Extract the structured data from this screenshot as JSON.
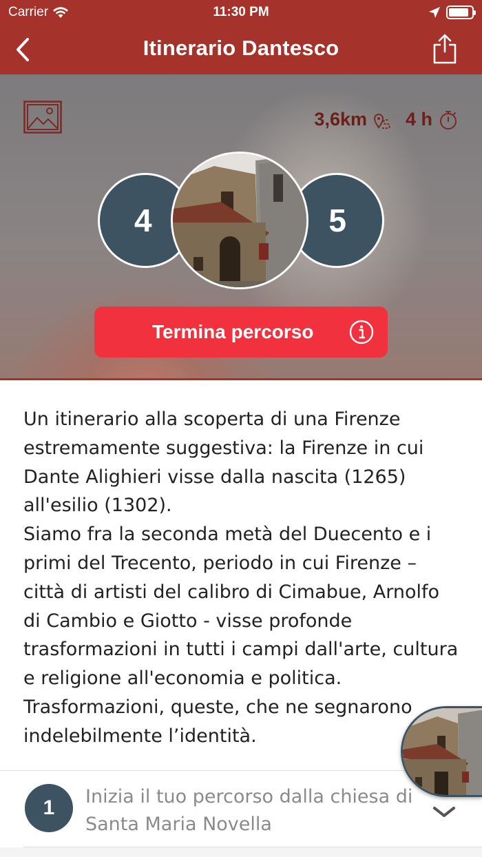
{
  "status_bar": {
    "carrier": "Carrier",
    "time": "11:30 PM",
    "battery_level": 0.9
  },
  "nav": {
    "title": "Itinerario Dantesco",
    "back_icon": "chevron-left-icon",
    "share_icon": "share-icon"
  },
  "hero": {
    "gallery_icon": "image-icon",
    "distance": "3,6km",
    "distance_icon": "route-icon",
    "duration": "4 h",
    "duration_icon": "stopwatch-icon",
    "prev_stop": "4",
    "next_stop": "5",
    "end_button_label": "Termina percorso",
    "info_icon": "info-icon"
  },
  "description": {
    "text": "Un itinerario alla scoperta di una Firenze\nestremamente suggestiva: la Firenze in cui\nDante Alighieri visse dalla nascita (1265)\nall'esilio (1302).\nSiamo fra la seconda metà del Duecento e i\nprimi del Trecento, periodo in cui Firenze –\ncittà di artisti del calibro di  Cimabue, Arnolfo\ndi Cambio e Giotto -  visse profonde\ntrasformazioni in tutti i campi dall'arte, cultura\ne religione all'economia e politica.\nTrasformazioni, queste, che ne segnarono\nindelebilmente l’identità."
  },
  "steps": [
    {
      "number": "1",
      "text": "Inizia il tuo percorso dalla chiesa di\nSanta Maria Novella",
      "chevron_icon": "chevron-down-icon"
    }
  ],
  "colors": {
    "primary": "#a6332b",
    "accent": "#f1313d",
    "stop_circle": "#3d5361"
  }
}
